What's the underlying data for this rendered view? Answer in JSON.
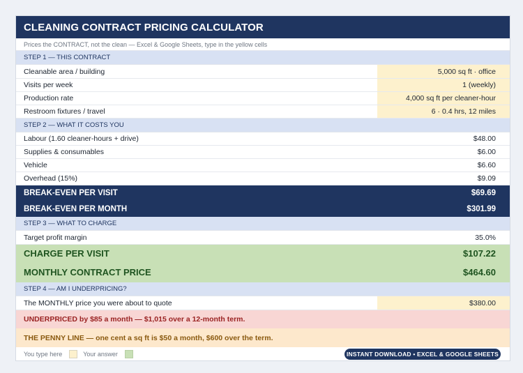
{
  "header": {
    "title": "CLEANING CONTRACT PRICING CALCULATOR",
    "subtitle": "Prices the CONTRACT, not the clean — Excel & Google Sheets, type in the yellow cells"
  },
  "step1": {
    "title": "STEP 1 — THIS CONTRACT",
    "rows": [
      {
        "label": "Cleanable area / building",
        "value": "5,000 sq ft  ·  office"
      },
      {
        "label": "Visits per week",
        "value": "1  (weekly)"
      },
      {
        "label": "Production rate",
        "value": "4,000 sq ft per cleaner-hour"
      },
      {
        "label": "Restroom fixtures / travel",
        "value": "6  ·  0.4 hrs, 12 miles"
      }
    ]
  },
  "step2": {
    "title": "STEP 2 — WHAT IT COSTS YOU",
    "rows": [
      {
        "label": "Labour  (1.60 cleaner-hours + drive)",
        "value": "$48.00"
      },
      {
        "label": "Supplies & consumables",
        "value": "$6.00"
      },
      {
        "label": "Vehicle",
        "value": "$6.60"
      },
      {
        "label": "Overhead (15%)",
        "value": "$9.09"
      }
    ],
    "breakeven_visit": {
      "label": "BREAK-EVEN PER VISIT",
      "value": "$69.69"
    },
    "breakeven_month": {
      "label": "BREAK-EVEN PER MONTH",
      "value": "$301.99"
    }
  },
  "step3": {
    "title": "STEP 3 — WHAT TO CHARGE",
    "margin": {
      "label": "Target profit margin",
      "value": "35.0%"
    },
    "charge_visit": {
      "label": "CHARGE PER VISIT",
      "value": "$107.22"
    },
    "monthly_price": {
      "label": "MONTHLY CONTRACT PRICE",
      "value": "$464.60"
    }
  },
  "step4": {
    "title": "STEP 4 — AM I UNDERPRICING?",
    "quote": {
      "label": "The MONTHLY price you were about to quote",
      "value": "$380.00"
    },
    "alert_under": "UNDERPRICED by $85 a month — $1,015 over a 12-month term.",
    "alert_penny": "THE PENNY LINE — one cent a sq ft is $50 a month, $600 over the term."
  },
  "legend": {
    "type_here": "You type here",
    "your_answer": "Your answer",
    "badge": "INSTANT DOWNLOAD  •  EXCEL & GOOGLE SHEETS"
  },
  "colors": {
    "navy": "#1f3560",
    "input_yellow": "#fdf1cd",
    "answer_green": "#c8e0b6",
    "step_blue": "#d8e1f3",
    "alert_red": "#f8d6d4",
    "alert_amber": "#fde8cc"
  }
}
